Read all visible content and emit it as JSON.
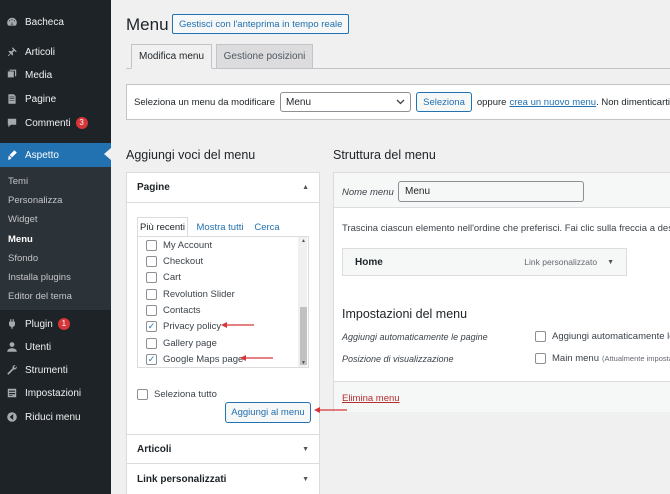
{
  "sidebar": {
    "items": [
      {
        "key": "dashboard",
        "label": "Bacheca",
        "icon": "dashboard-icon"
      },
      {
        "key": "posts",
        "label": "Articoli",
        "icon": "pin-icon"
      },
      {
        "key": "media",
        "label": "Media",
        "icon": "media-icon"
      },
      {
        "key": "pages",
        "label": "Pagine",
        "icon": "page-icon"
      },
      {
        "key": "comments",
        "label": "Commenti",
        "icon": "comment-icon",
        "badge": "3"
      },
      {
        "key": "appearance",
        "label": "Aspetto",
        "icon": "brush-icon",
        "active": true
      },
      {
        "key": "plugins",
        "label": "Plugin",
        "icon": "plugin-icon",
        "badge": "1"
      },
      {
        "key": "users",
        "label": "Utenti",
        "icon": "user-icon"
      },
      {
        "key": "tools",
        "label": "Strumenti",
        "icon": "wrench-icon"
      },
      {
        "key": "settings",
        "label": "Impostazioni",
        "icon": "settings-icon"
      },
      {
        "key": "collapse",
        "label": "Riduci menu",
        "icon": "collapse-icon"
      }
    ],
    "submenu": [
      "Temi",
      "Personalizza",
      "Widget",
      "Menu",
      "Sfondo",
      "Installa plugins",
      "Editor del tema"
    ],
    "submenu_current": "Menu"
  },
  "header": {
    "title": "Menu",
    "preview_button": "Gestisci con l'anteprima in tempo reale"
  },
  "tabs": {
    "edit": "Modifica menu",
    "locations": "Gestione posizioni"
  },
  "select_bar": {
    "label": "Seleziona un menu da modificare",
    "selected": "Menu",
    "button": "Seleziona",
    "or_text": "oppure",
    "create_link": "crea un nuovo menu",
    "tail": ". Non dimenticarti"
  },
  "add_items": {
    "heading": "Aggiungi voci del menu",
    "pages_section": "Pagine",
    "inner_tabs": {
      "recent": "Più recenti",
      "all": "Mostra tutti",
      "search": "Cerca"
    },
    "pages": [
      {
        "label": "My Account",
        "checked": false
      },
      {
        "label": "Checkout",
        "checked": false
      },
      {
        "label": "Cart",
        "checked": false
      },
      {
        "label": "Revolution Slider",
        "checked": false
      },
      {
        "label": "Contacts",
        "checked": false
      },
      {
        "label": "Privacy policy",
        "checked": true
      },
      {
        "label": "Gallery page",
        "checked": false
      },
      {
        "label": "Google Maps page",
        "checked": true
      }
    ],
    "select_all": "Seleziona tutto",
    "add_button": "Aggiungi al menu",
    "posts_section": "Articoli",
    "custom_links_section": "Link personalizzati"
  },
  "structure": {
    "heading": "Struttura del menu",
    "name_label": "Nome menu",
    "name_value": "Menu",
    "instructions": "Trascina ciascun elemento nell'ordine che preferisci. Fai clic sulla freccia a destra del",
    "menu_items": [
      {
        "title": "Home",
        "type": "Link personalizzato"
      }
    ],
    "settings_heading": "Impostazioni del menu",
    "auto_add_label": "Aggiungi automaticamente le pagine",
    "auto_add_value": "Aggiungi automaticamente le",
    "location_label": "Posizione di visualizzazione",
    "location_value": "Main menu",
    "location_note": "(Attualmente imposta",
    "delete_link": "Elimina menu"
  },
  "colors": {
    "sidebar_bg": "#1d2327",
    "accent": "#2271b1",
    "badge": "#d63638",
    "annotation_arrow": "#d63638"
  }
}
